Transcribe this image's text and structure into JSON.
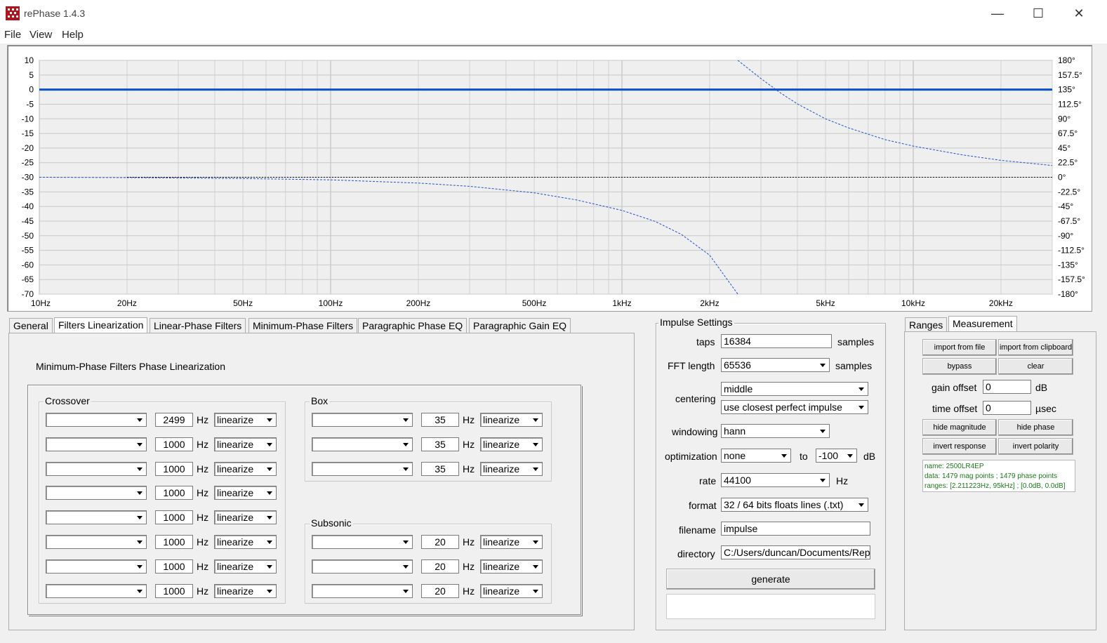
{
  "window": {
    "title": "rePhase 1.4.3"
  },
  "menu": [
    "File",
    "View",
    "Help"
  ],
  "chart_data": {
    "type": "line",
    "x_scale": "log",
    "xlim": [
      10,
      30000
    ],
    "x_ticks": [
      {
        "v": 10,
        "label": "10Hz"
      },
      {
        "v": 20,
        "label": "20Hz"
      },
      {
        "v": 50,
        "label": "50Hz"
      },
      {
        "v": 100,
        "label": "100Hz"
      },
      {
        "v": 200,
        "label": "200Hz"
      },
      {
        "v": 500,
        "label": "500Hz"
      },
      {
        "v": 1000,
        "label": "1kHz"
      },
      {
        "v": 2000,
        "label": "2kHz"
      },
      {
        "v": 5000,
        "label": "5kHz"
      },
      {
        "v": 10000,
        "label": "10kHz"
      },
      {
        "v": 20000,
        "label": "20kHz"
      }
    ],
    "ylim_left": [
      -70,
      10
    ],
    "y_ticks_left": [
      "10",
      "5",
      "0",
      "-5",
      "-10",
      "-15",
      "-20",
      "-25",
      "-30",
      "-35",
      "-40",
      "-45",
      "-50",
      "-55",
      "-60",
      "-65",
      "-70"
    ],
    "ylim_right": [
      -180,
      180
    ],
    "y_ticks_right": [
      "180°",
      "157.5°",
      "135°",
      "112.5°",
      "90°",
      "67.5°",
      "45°",
      "22.5°",
      "0°",
      "-22.5°",
      "-45°",
      "-67.5°",
      "-90°",
      "-112.5°",
      "-135°",
      "-157.5°",
      "-180°"
    ],
    "grid": true,
    "series": [
      {
        "axis": "left",
        "style": "solid",
        "color": "#0a50d0",
        "x": [
          10,
          30000
        ],
        "y": [
          0,
          0
        ]
      },
      {
        "axis": "right",
        "style": "dashed",
        "color": "#2050d0",
        "x": [
          10,
          20,
          50,
          100,
          200,
          300,
          500,
          700,
          1000,
          1300,
          1600,
          2000,
          2500
        ],
        "y": [
          0,
          -0.5,
          -2,
          -4,
          -9,
          -14,
          -24,
          -35,
          -51,
          -68,
          -88,
          -120,
          -180
        ]
      },
      {
        "axis": "right",
        "style": "dashed",
        "color": "#2050d0",
        "x": [
          2500,
          3000,
          3500,
          4000,
          5000,
          6000,
          8000,
          10000,
          15000,
          20000,
          30000
        ],
        "y": [
          180,
          152,
          130,
          113,
          90,
          76,
          58,
          48,
          34,
          26,
          18
        ]
      },
      {
        "axis": "right",
        "style": "dotted",
        "color": "#000000",
        "x": [
          20,
          30000
        ],
        "y": [
          0,
          0
        ]
      }
    ]
  },
  "tabs": [
    "General",
    "Filters Linearization",
    "Linear-Phase Filters",
    "Minimum-Phase Filters",
    "Paragraphic Phase EQ",
    "Paragraphic Gain EQ"
  ],
  "linearization": {
    "heading": "Minimum-Phase Filters Phase Linearization",
    "crossover_label": "Crossover",
    "box_label": "Box",
    "subsonic_label": "Subsonic",
    "hz": "Hz",
    "crossover": [
      {
        "type": "",
        "freq": "2499",
        "mode": "linearize"
      },
      {
        "type": "",
        "freq": "1000",
        "mode": "linearize"
      },
      {
        "type": "",
        "freq": "1000",
        "mode": "linearize"
      },
      {
        "type": "",
        "freq": "1000",
        "mode": "linearize"
      },
      {
        "type": "",
        "freq": "1000",
        "mode": "linearize"
      },
      {
        "type": "",
        "freq": "1000",
        "mode": "linearize"
      },
      {
        "type": "",
        "freq": "1000",
        "mode": "linearize"
      },
      {
        "type": "",
        "freq": "1000",
        "mode": "linearize"
      }
    ],
    "box": [
      {
        "type": "",
        "freq": "35",
        "mode": "linearize"
      },
      {
        "type": "",
        "freq": "35",
        "mode": "linearize"
      },
      {
        "type": "",
        "freq": "35",
        "mode": "linearize"
      }
    ],
    "subsonic": [
      {
        "type": "",
        "freq": "20",
        "mode": "linearize"
      },
      {
        "type": "",
        "freq": "20",
        "mode": "linearize"
      },
      {
        "type": "",
        "freq": "20",
        "mode": "linearize"
      }
    ]
  },
  "impulse": {
    "group_label": "Impulse Settings",
    "taps_label": "taps",
    "taps": "16384",
    "samples": "samples",
    "fft_label": "FFT length",
    "fft": "65536",
    "centering_label": "centering",
    "centering": "middle",
    "centering2": "use closest perfect impulse",
    "windowing_label": "windowing",
    "windowing": "hann",
    "optimization_label": "optimization",
    "optimization": "none",
    "to": "to",
    "opt_to": "-100",
    "db": "dB",
    "rate_label": "rate",
    "rate": "44100",
    "hz": "Hz",
    "format_label": "format",
    "format": "32 / 64 bits floats lines (.txt)",
    "filename_label": "filename",
    "filename": "impulse",
    "directory_label": "directory",
    "directory": "C:/Users/duncan/Documents/Rep",
    "generate": "generate",
    "status": ""
  },
  "measurement": {
    "tabs": [
      "Ranges",
      "Measurement"
    ],
    "import_file": "import from file",
    "import_clipboard": "import from clipboard",
    "bypass": "bypass",
    "clear": "clear",
    "gain_offset_label": "gain offset",
    "gain_offset": "0",
    "db": "dB",
    "time_offset_label": "time offset",
    "time_offset": "0",
    "usec": "µsec",
    "hide_magnitude": "hide magnitude",
    "hide_phase": "hide phase",
    "invert_response": "invert response",
    "invert_polarity": "invert polarity",
    "info_name": "name: 2500LR4EP",
    "info_data": "data: 1479 mag points ; 1479 phase points",
    "info_ranges": "ranges: [2.211223Hz, 95kHz] ; [0.0dB, 0.0dB]"
  }
}
